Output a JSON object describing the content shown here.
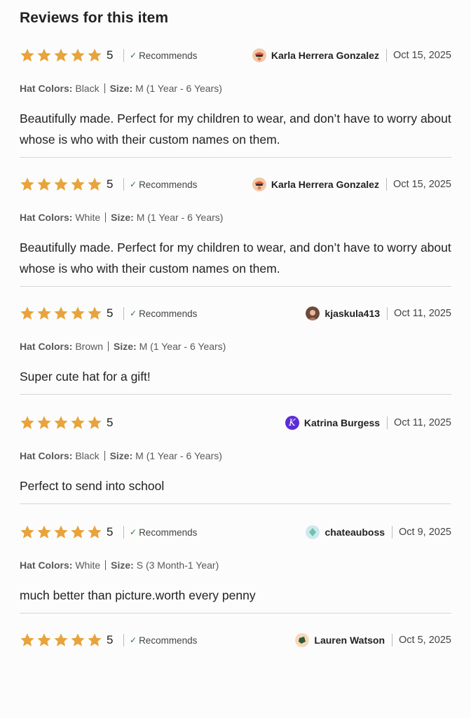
{
  "header": {
    "title": "Reviews for this item"
  },
  "colors": {
    "star": "#e8a33b",
    "check": "#2c7a3a"
  },
  "reviews": [
    {
      "rating": "5",
      "recommends": "Recommends",
      "user": "Karla Herrera Gonzalez",
      "date": "Oct 15, 2025",
      "hat_colors_label": "Hat Colors:",
      "hat_colors": "Black",
      "size_label": "Size:",
      "size": "M (1 Year - 6 Years)",
      "text": "Beautifully made. Perfect for my children to wear, and don’t have to worry about whose is who with their custom names on them."
    },
    {
      "rating": "5",
      "recommends": "Recommends",
      "user": "Karla Herrera Gonzalez",
      "date": "Oct 15, 2025",
      "hat_colors_label": "Hat Colors:",
      "hat_colors": "White",
      "size_label": "Size:",
      "size": "M (1 Year - 6 Years)",
      "text": "Beautifully made. Perfect for my children to wear, and don’t have to worry about whose is who with their custom names on them."
    },
    {
      "rating": "5",
      "recommends": "Recommends",
      "user": "kjaskula413",
      "date": "Oct 11, 2025",
      "hat_colors_label": "Hat Colors:",
      "hat_colors": "Brown",
      "size_label": "Size:",
      "size": "M (1 Year - 6 Years)",
      "text": "Super cute hat for a gift!"
    },
    {
      "rating": "5",
      "user": "Katrina Burgess",
      "avatar_letter": "K",
      "date": "Oct 11, 2025",
      "hat_colors_label": "Hat Colors:",
      "hat_colors": "Black",
      "size_label": "Size:",
      "size": "M (1 Year - 6 Years)",
      "text": "Perfect to send into school"
    },
    {
      "rating": "5",
      "recommends": "Recommends",
      "user": "chateauboss",
      "date": "Oct 9, 2025",
      "hat_colors_label": "Hat Colors:",
      "hat_colors": "White",
      "size_label": "Size:",
      "size": "S (3 Month-1 Year)",
      "text": "much better than picture.worth every penny"
    },
    {
      "rating": "5",
      "recommends": "Recommends",
      "user": "Lauren Watson",
      "date": "Oct 5, 2025"
    }
  ]
}
